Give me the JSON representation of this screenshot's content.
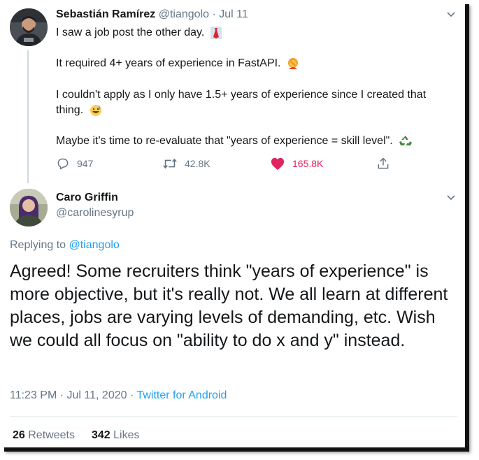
{
  "tweet1": {
    "name": "Sebastián Ramírez",
    "handle": "@tiangolo",
    "separator": "·",
    "date": "Jul 11",
    "lines": [
      "I saw a job post the other day.",
      "It required 4+ years of experience in FastAPI.",
      "I couldn't apply as I only have 1.5+ years of experience since I created that thing.",
      "Maybe it's time to re-evaluate that \"years of experience = skill level\"."
    ],
    "emojis": [
      "necktie-emoji",
      "woman-facepalming-emoji",
      "grinning-sweat-emoji",
      "recycle-emoji"
    ],
    "actions": {
      "replies": "947",
      "retweets": "42.8K",
      "likes": "165.8K"
    },
    "colors": {
      "like": "#e0245e",
      "muted": "#657786"
    }
  },
  "tweet2": {
    "name": "Caro Griffin",
    "handle": "@carolinesyrup",
    "replying_prefix": "Replying to",
    "replying_to": "@tiangolo",
    "text": "Agreed! Some recruiters think \"years of experience\" is more objective, but it's really not. We all learn at different places, jobs are varying levels of demanding, etc. Wish we could all focus on \"ability to do x and y\" instead.",
    "time": "11:23 PM · Jul 11, 2020",
    "meta_separator": "·",
    "source": "Twitter for Android",
    "stats": {
      "retweets_count": "26",
      "retweets_label": "Retweets",
      "likes_count": "342",
      "likes_label": "Likes"
    },
    "colors": {
      "link": "#1da1f2"
    }
  }
}
